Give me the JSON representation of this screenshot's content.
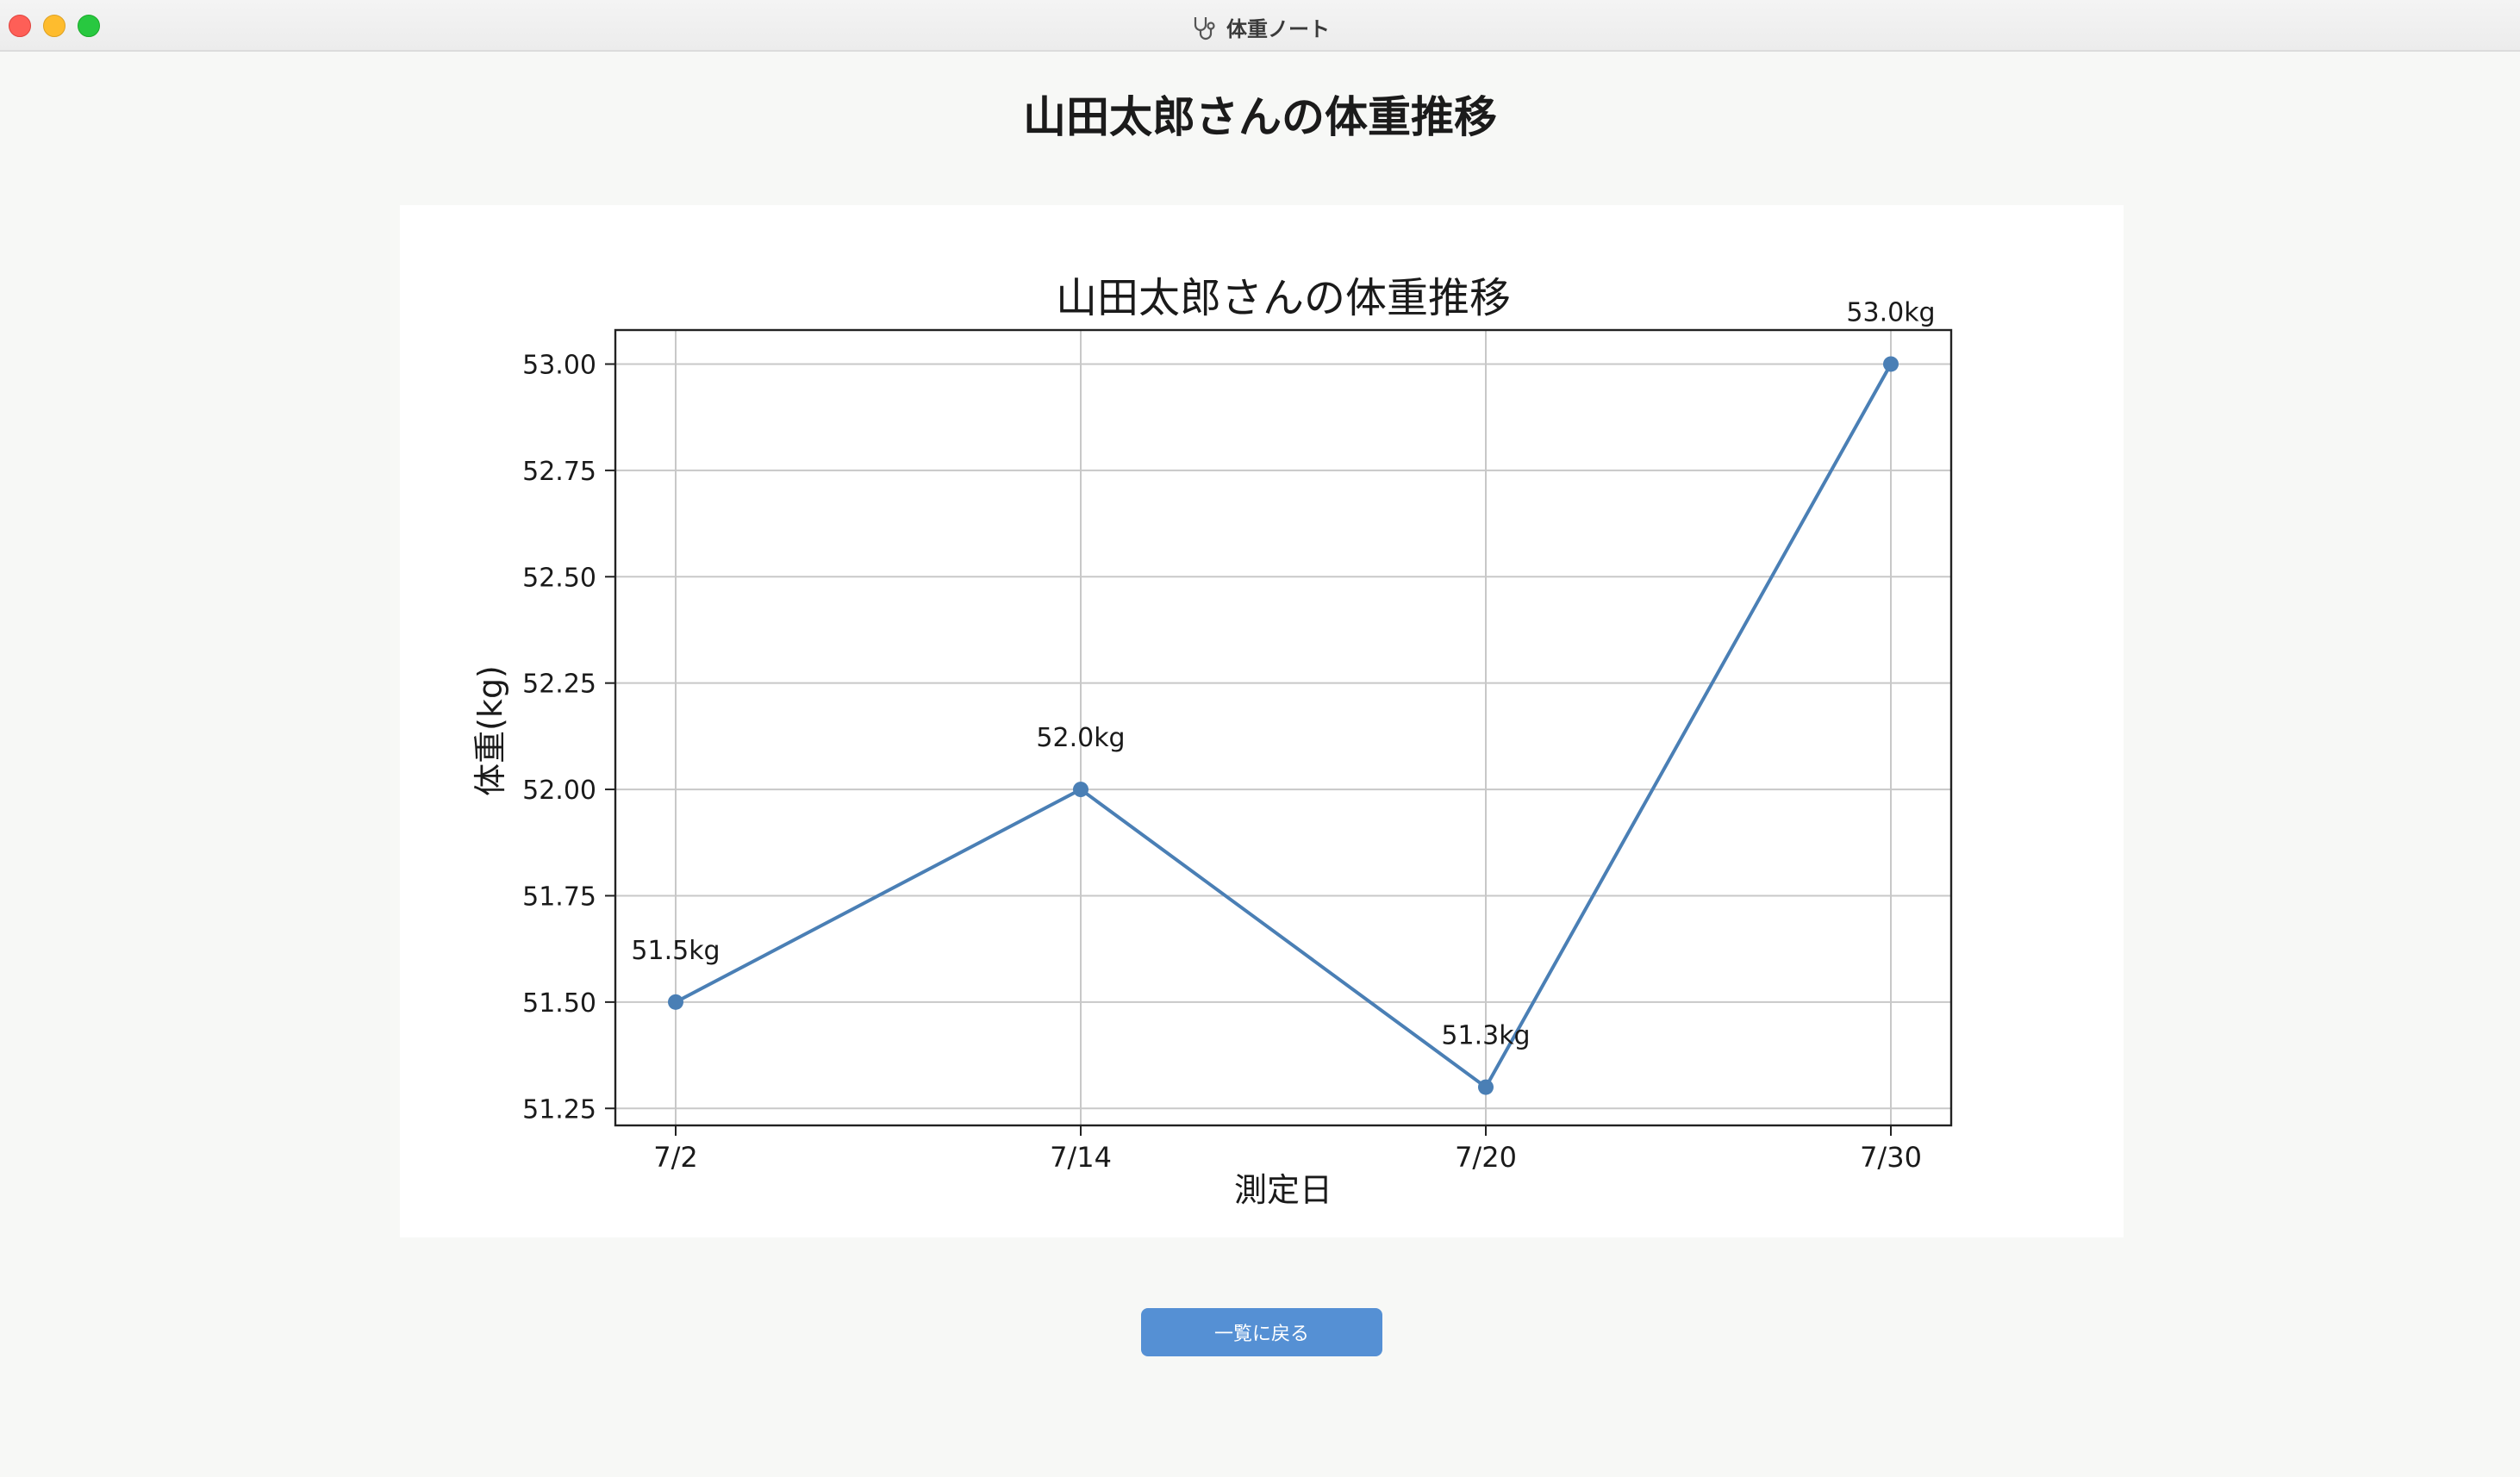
{
  "window": {
    "title": "体重ノート",
    "icon": "stethoscope-icon"
  },
  "page": {
    "title": "山田太郎さんの体重推移"
  },
  "actions": {
    "back_label": "一覧に戻る"
  },
  "colors": {
    "accent": "#5590d4",
    "line": "#4a7fb5",
    "grid": "#c8c8c8"
  },
  "chart_data": {
    "type": "line",
    "title": "山田太郎さんの体重推移",
    "xlabel": "測定日",
    "ylabel": "体重(kg)",
    "categories": [
      "7/2",
      "7/14",
      "7/20",
      "7/30"
    ],
    "values": [
      51.5,
      52.0,
      51.3,
      53.0
    ],
    "data_labels": [
      "51.5kg",
      "52.0kg",
      "51.3kg",
      "53.0kg"
    ],
    "yticks": [
      "51.25",
      "51.50",
      "51.75",
      "52.00",
      "52.25",
      "52.50",
      "52.75",
      "53.00"
    ],
    "ylim": [
      51.21,
      53.08
    ],
    "grid": true,
    "legend": "none"
  }
}
